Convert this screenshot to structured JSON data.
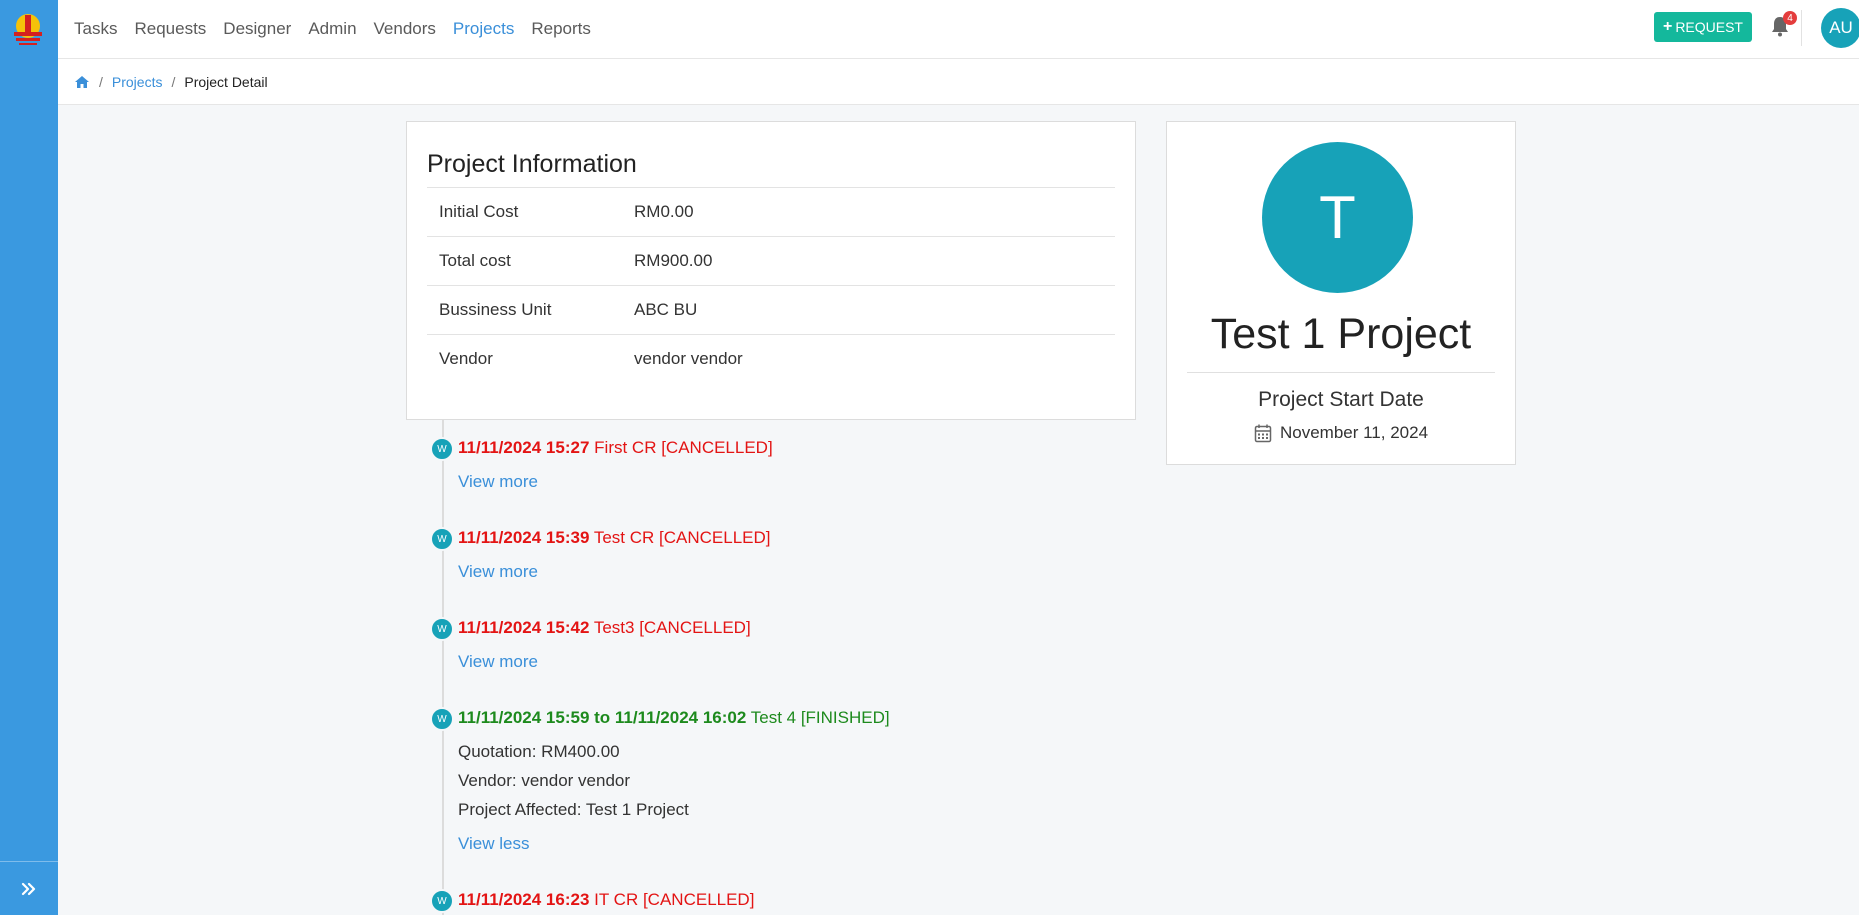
{
  "nav": {
    "items": [
      "Tasks",
      "Requests",
      "Designer",
      "Admin",
      "Vendors",
      "Projects",
      "Reports"
    ],
    "active": "Projects",
    "request_button": "REQUEST",
    "notification_count": "4",
    "user_initials": "AU"
  },
  "breadcrumb": {
    "projects": "Projects",
    "current": "Project Detail"
  },
  "project_info": {
    "title": "Project Information",
    "rows": [
      {
        "label": "Initial Cost",
        "value": "RM0.00"
      },
      {
        "label": "Total cost",
        "value": "RM900.00"
      },
      {
        "label": "Bussiness Unit",
        "value": "ABC BU"
      },
      {
        "label": "Vendor",
        "value": "vendor vendor"
      }
    ]
  },
  "profile": {
    "initial": "T",
    "name": "Test 1 Project",
    "start_label": "Project Start Date",
    "start_date": "November 11, 2024"
  },
  "timeline": [
    {
      "avatar": "W",
      "time": "11/11/2024 15:27",
      "title": "First CR [CANCELLED]",
      "link": "View more"
    },
    {
      "avatar": "W",
      "time": "11/11/2024 15:39",
      "title": "Test CR [CANCELLED]",
      "link": "View more"
    },
    {
      "avatar": "W",
      "time": "11/11/2024 15:42",
      "title": "Test3 [CANCELLED]",
      "link": "View more"
    },
    {
      "avatar": "W",
      "time": "11/11/2024 15:59 to 11/11/2024 16:02",
      "title": "Test 4 [FINISHED]",
      "details": [
        "Quotation: RM400.00",
        "Vendor: vendor vendor",
        "Project Affected: Test 1 Project"
      ],
      "link": "View less"
    },
    {
      "avatar": "W",
      "time": "11/11/2024 16:23",
      "title": "IT CR [CANCELLED]"
    }
  ],
  "colors": {
    "sidebar": "#3a99e0",
    "accent": "#17a2b8",
    "request_button": "#14b89c",
    "cancelled": "#e31414",
    "finished": "#1d8a1d"
  }
}
